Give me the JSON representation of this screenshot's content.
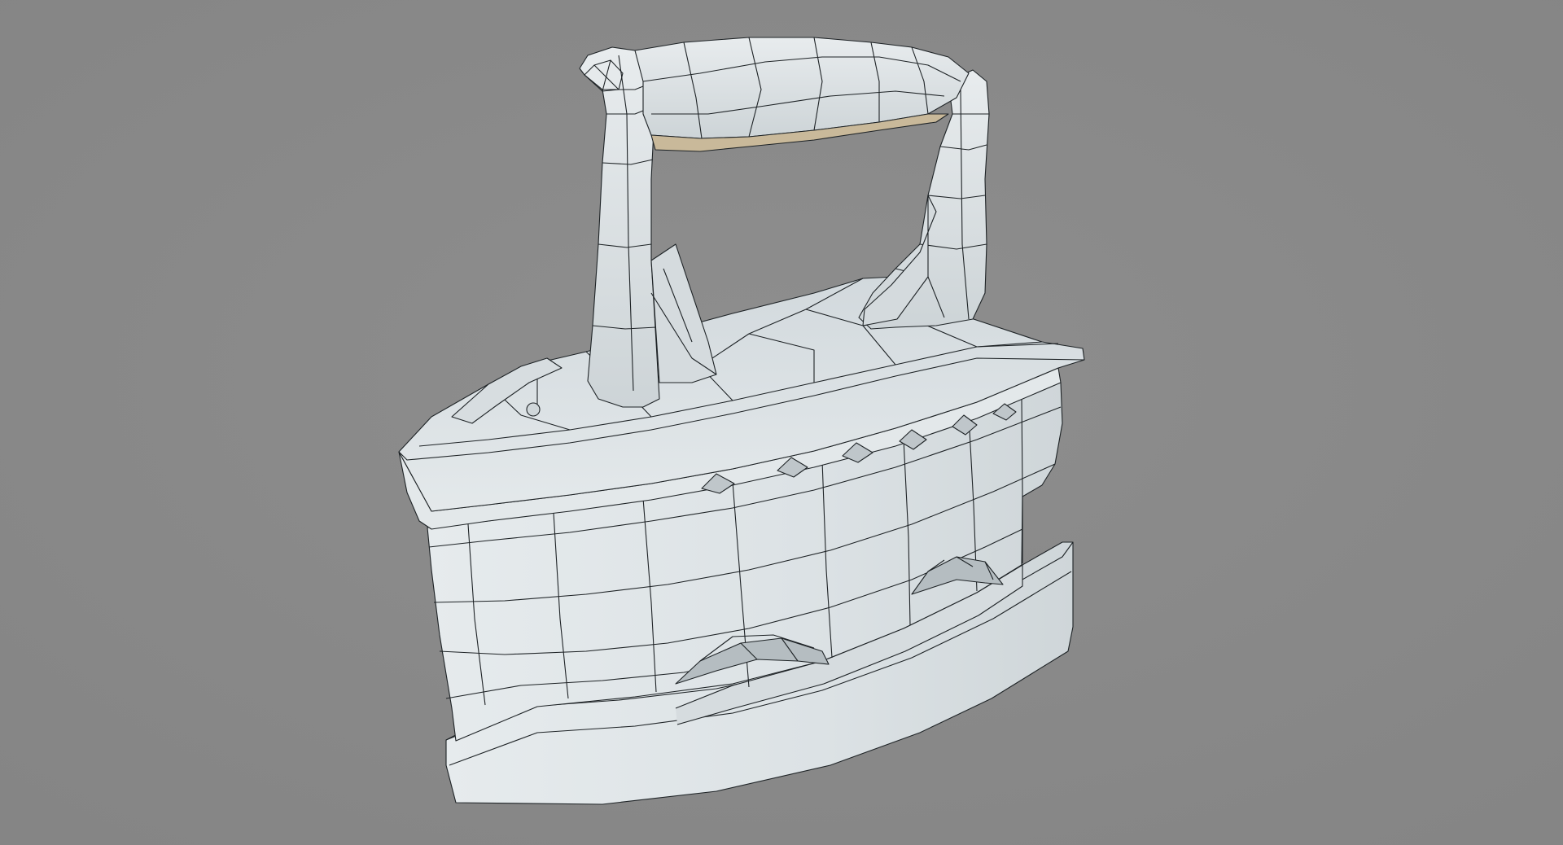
{
  "viewport": {
    "background": "#8a8a8a",
    "model": {
      "subject": "cast-iron-coal-iron",
      "display_mode": "wireframe-on-shaded",
      "surface_color": "#dde3e6",
      "shadow_color": "#b9c0c4",
      "wire_color": "#1e2326"
    }
  }
}
